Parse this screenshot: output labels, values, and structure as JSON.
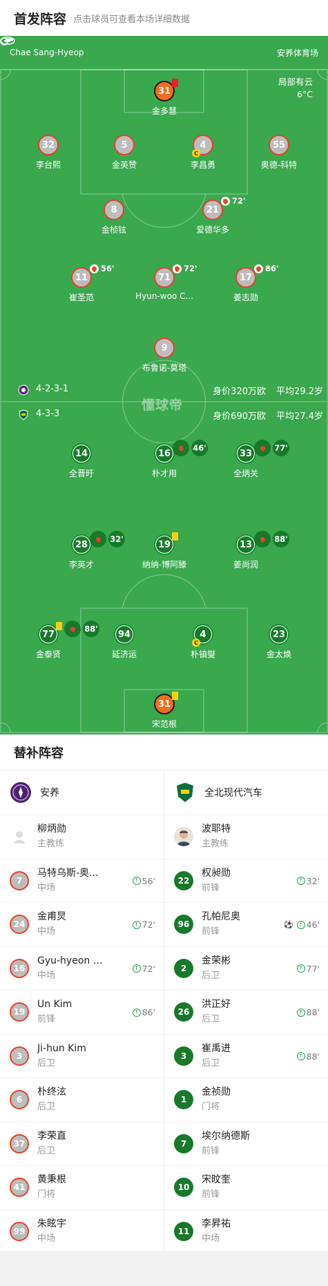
{
  "header": {
    "title": "首发阵容",
    "subtitle": "点击球员可查看本场详细数据"
  },
  "match": {
    "referee": "Chae Sang-Hyeop",
    "stadium": "安养体育场",
    "weather": "局部有云",
    "temperature": "6°C"
  },
  "watermark": "懂球帝",
  "home_info": {
    "formation": "4-2-3-1",
    "value": "身价320万欧",
    "avg_age": "平均29.2岁"
  },
  "away_info": {
    "formation": "4-3-3",
    "value": "身价690万欧",
    "avg_age": "平均27.4岁"
  },
  "home_players": [
    {
      "num": "31",
      "name": "金多慧",
      "gk": true,
      "card": "red"
    },
    {
      "num": "32",
      "name": "李台熙"
    },
    {
      "num": "5",
      "name": "金英赞"
    },
    {
      "num": "4",
      "name": "李昌勇",
      "captain": "C"
    },
    {
      "num": "55",
      "name": "奥德-科特"
    },
    {
      "num": "8",
      "name": "金桢铉"
    },
    {
      "num": "21",
      "name": "爱德华多",
      "sub": "72'"
    },
    {
      "num": "11",
      "name": "崔圣范",
      "sub": "56'"
    },
    {
      "num": "71",
      "name": "Hyun-woo C...",
      "sub": "72'"
    },
    {
      "num": "17",
      "name": "姜志勋",
      "sub": "86'"
    },
    {
      "num": "9",
      "name": "布鲁诺-莫塔"
    }
  ],
  "away_players": [
    {
      "num": "14",
      "name": "全晋旴"
    },
    {
      "num": "16",
      "name": "朴才用",
      "sub": "46'"
    },
    {
      "num": "33",
      "name": "全炳关",
      "sub": "77'"
    },
    {
      "num": "28",
      "name": "李英才",
      "sub": "32'"
    },
    {
      "num": "19",
      "name": "纳纳-博阿滕",
      "card": "yellow"
    },
    {
      "num": "13",
      "name": "姜尚润",
      "sub": "88'"
    },
    {
      "num": "77",
      "name": "金泰贤",
      "card": "yellow",
      "sub": "88'"
    },
    {
      "num": "94",
      "name": "延济运"
    },
    {
      "num": "4",
      "name": "朴镇燮",
      "captain": "C"
    },
    {
      "num": "23",
      "name": "金太焕"
    },
    {
      "num": "31",
      "name": "宋范根",
      "gk": true,
      "card": "yellow"
    }
  ],
  "subs_title": "替补阵容",
  "home_team": {
    "name": "安养",
    "coach": {
      "name": "柳炳勋",
      "role": "主教练"
    },
    "subs": [
      {
        "num": "7",
        "name": "马特乌斯-奥...",
        "pos": "中场",
        "min": "56'"
      },
      {
        "num": "24",
        "name": "金甫炅",
        "pos": "中场",
        "min": "72'"
      },
      {
        "num": "16",
        "name": "Gyu-hyeon C...",
        "pos": "中场",
        "min": "72'"
      },
      {
        "num": "19",
        "name": "Un Kim",
        "pos": "前锋",
        "min": "86'"
      },
      {
        "num": "3",
        "name": "Ji-hun Kim",
        "pos": "后卫"
      },
      {
        "num": "6",
        "name": "朴终泫",
        "pos": "后卫"
      },
      {
        "num": "37",
        "name": "李荣直",
        "pos": "后卫"
      },
      {
        "num": "41",
        "name": "黄秉根",
        "pos": "门将"
      },
      {
        "num": "99",
        "name": "朱眩宇",
        "pos": "中场"
      }
    ]
  },
  "away_team": {
    "name": "全北现代汽车",
    "coach": {
      "name": "波耶特",
      "role": "主教练"
    },
    "subs": [
      {
        "num": "22",
        "name": "权昶勋",
        "pos": "前锋",
        "min": "32'"
      },
      {
        "num": "96",
        "name": "孔帕尼奥",
        "pos": "前锋",
        "min": "46'",
        "goal": true
      },
      {
        "num": "2",
        "name": "金荣彬",
        "pos": "后卫",
        "min": "77'"
      },
      {
        "num": "26",
        "name": "洪正好",
        "pos": "后卫",
        "min": "88'"
      },
      {
        "num": "3",
        "name": "崔禹进",
        "pos": "后卫",
        "min": "88'"
      },
      {
        "num": "1",
        "name": "金祯勋",
        "pos": "门将"
      },
      {
        "num": "7",
        "name": "埃尔纳德斯",
        "pos": "前锋"
      },
      {
        "num": "10",
        "name": "宋旼奎",
        "pos": "前锋"
      },
      {
        "num": "11",
        "name": "李昇祐",
        "pos": "中场"
      }
    ]
  },
  "colors": {
    "pitch": "#3aa84d",
    "home_ring": "#e8412b",
    "away_fill": "#177a2a",
    "gk": "#f26a1b"
  }
}
